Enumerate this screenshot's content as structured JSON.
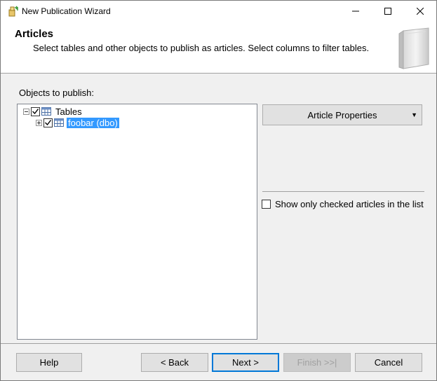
{
  "window": {
    "title": "New Publication Wizard"
  },
  "header": {
    "title": "Articles",
    "description": "Select tables and other objects to publish as articles. Select columns to filter tables."
  },
  "objects_panel": {
    "label": "Objects to publish:",
    "tree": [
      {
        "label": "Tables",
        "checked": true,
        "expanded": true,
        "icon": "table-icon"
      },
      {
        "label": "foobar (dbo)",
        "checked": true,
        "expanded": false,
        "selected": true,
        "icon": "table-icon"
      }
    ]
  },
  "right_panel": {
    "article_properties_label": "Article Properties",
    "show_only_checked_label": "Show only checked articles in the list",
    "show_only_checked": false
  },
  "footer": {
    "help_label": "Help",
    "back_label": "< Back",
    "next_label": "Next >",
    "finish_label": "Finish >>|",
    "cancel_label": "Cancel"
  },
  "colors": {
    "selection": "#3399ff",
    "default_button_border": "#0078d7",
    "window_bg": "#f0f0f0"
  }
}
